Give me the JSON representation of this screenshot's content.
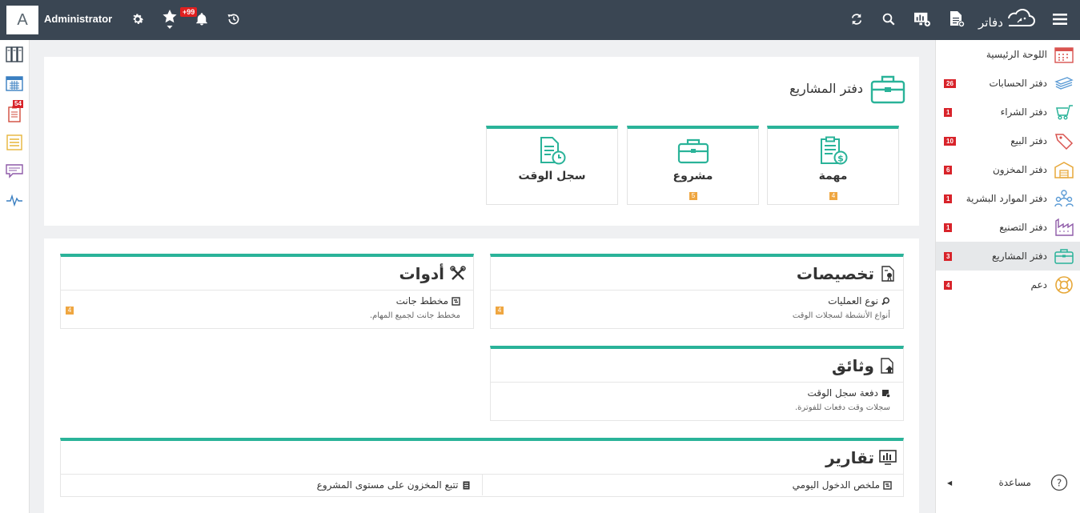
{
  "topbar": {
    "avatar_letter": "A",
    "username": "Administrator",
    "notifications_badge": "+99",
    "brand_name": "دفاتر"
  },
  "leftstrip": {
    "badge": "54"
  },
  "sidebar": {
    "items": [
      {
        "label": "اللوحة الرئيسية",
        "badge": "",
        "icon": "dashboard-grid-icon"
      },
      {
        "label": "دفتر الحسابات",
        "badge": "26",
        "icon": "money-stack-icon"
      },
      {
        "label": "دفتر الشراء",
        "badge": "1",
        "icon": "cart-icon"
      },
      {
        "label": "دفتر البيع",
        "badge": "10",
        "icon": "price-tag-icon"
      },
      {
        "label": "دفتر المخزون",
        "badge": "6",
        "icon": "warehouse-icon"
      },
      {
        "label": "دفتر الموارد البشرية",
        "badge": "1",
        "icon": "people-icon"
      },
      {
        "label": "دفتر التصنيع",
        "badge": "1",
        "icon": "factory-icon"
      },
      {
        "label": "دفتر المشاريع",
        "badge": "3",
        "icon": "briefcase-icon"
      },
      {
        "label": "دعم",
        "badge": "4",
        "icon": "lifebuoy-icon"
      }
    ],
    "help_label": "مساعدة"
  },
  "page": {
    "title": "دفتر المشاريع"
  },
  "tiles": [
    {
      "label": "مهمة",
      "count": "4"
    },
    {
      "label": "مشروع",
      "count": "5"
    },
    {
      "label": "سجل الوقت",
      "count": ""
    }
  ],
  "cards": {
    "customizations": {
      "title": "تخصيصات",
      "item_name": "نوع العمليات",
      "item_desc": "أنواع الأنشطة لسجلات الوقت",
      "item_count": "4"
    },
    "tools": {
      "title": "أدوات",
      "item_name": "مخطط جانت",
      "item_desc": "مخطط جانت لجميع المهام.",
      "item_count": "4"
    },
    "documents": {
      "title": "وثائق",
      "item_name": "دفعة سجل الوقت",
      "item_desc": "سجلات وقت دفعات للفوترة."
    },
    "reports": {
      "title": "تقارير",
      "item1": "ملخص الدخول اليومي",
      "item2": "تتبع المخزون على مستوى المشروع"
    }
  },
  "colors": {
    "topbar_bg": "#3a4653",
    "accent_teal": "#2ab399",
    "badge_red": "#d8232a",
    "count_orange": "#efa640"
  }
}
